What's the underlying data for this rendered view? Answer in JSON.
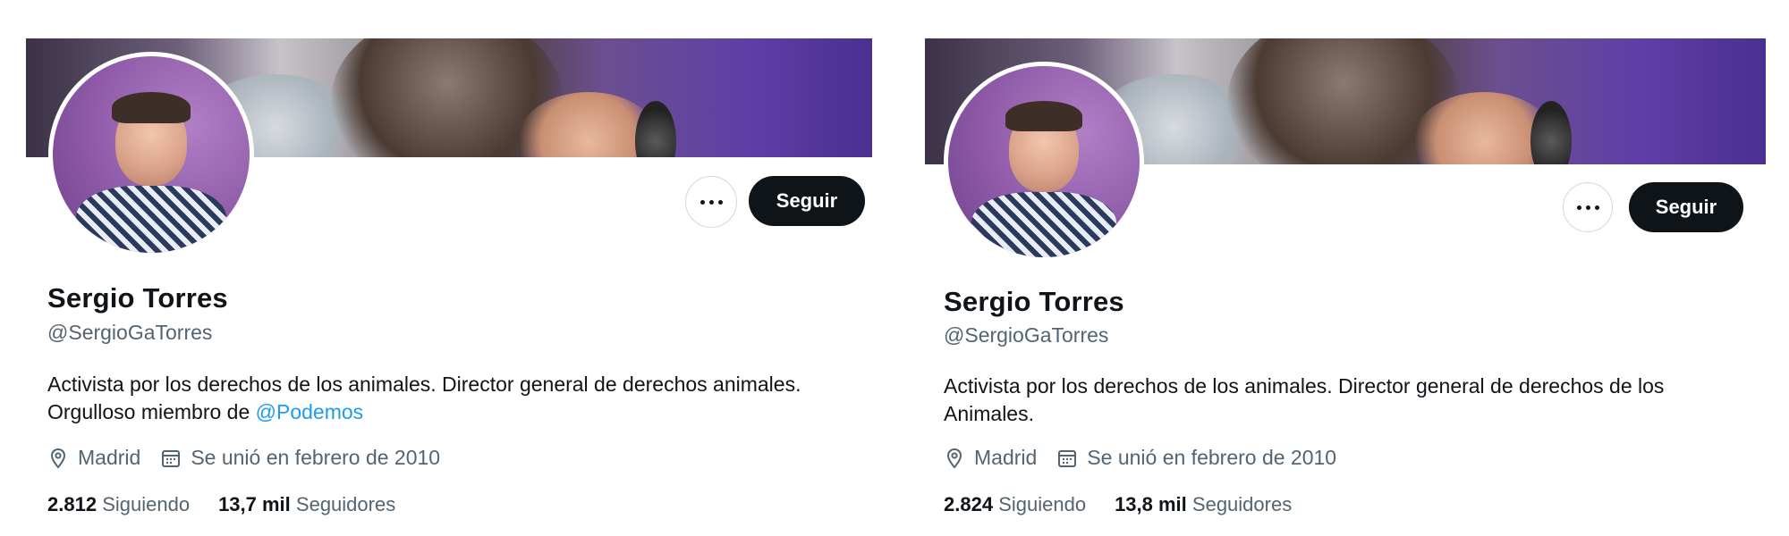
{
  "profiles": [
    {
      "name": "Sergio Torres",
      "handle": "@SergioGaTorres",
      "bio_text": "Activista por los derechos de los animales. Director general de derechos animales. Orgulloso miembro de ",
      "bio_mention": "@Podemos",
      "location": "Madrid",
      "joined": "Se unió en febrero de 2010",
      "following_count": "2.812",
      "following_label": "Siguiendo",
      "followers_count": "13,7 mil",
      "followers_label": "Seguidores",
      "follow_label": "Seguir"
    },
    {
      "name": "Sergio Torres",
      "handle": "@SergioGaTorres",
      "bio_text": "Activista por los derechos de los animales. Director general de derechos de los Animales.",
      "bio_mention": "",
      "location": "Madrid",
      "joined": "Se unió en febrero de 2010",
      "following_count": "2.824",
      "following_label": "Siguiendo",
      "followers_count": "13,8 mil",
      "followers_label": "Seguidores",
      "follow_label": "Seguir"
    }
  ],
  "colors": {
    "text": "#0f1419",
    "secondary": "#536471",
    "link": "#1d9bf0",
    "button_bg": "#0f1419"
  },
  "icons": {
    "more": "more-options-icon",
    "location": "location-pin-icon",
    "calendar": "calendar-icon"
  }
}
